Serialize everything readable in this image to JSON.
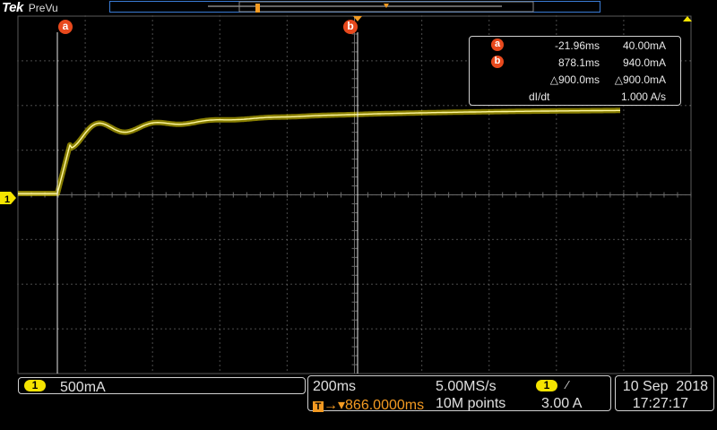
{
  "header": {
    "brand": "Tek",
    "mode": "PreVu"
  },
  "cursors": {
    "a_label": "a",
    "b_label": "b"
  },
  "readout": {
    "a_tag": "a",
    "a_time": "-21.96ms",
    "a_value": "40.00mA",
    "b_tag": "b",
    "b_time": "878.1ms",
    "b_value": "940.0mA",
    "delta_time": "△900.0ms",
    "delta_value": "△900.0mA",
    "deriv_label": "dI/dt",
    "deriv_value": "1.000 A/s"
  },
  "channel": {
    "number": "1",
    "scale": "500mA"
  },
  "timebase": {
    "time_per_div": "200ms",
    "sample_rate": "5.00MS/s",
    "trigger_position": "866.0000ms",
    "record_length": "10M points"
  },
  "trigger": {
    "source": "1",
    "slope_symbol": "⁄",
    "level": "3.00 A"
  },
  "datetime": {
    "date": "10 Sep  2018",
    "time": "17:27:17"
  },
  "colors": {
    "trace": "#f5e400",
    "cursor_tag": "#e8491d",
    "trigger": "#f39a22",
    "record_bar": "#3a7bd5"
  }
}
